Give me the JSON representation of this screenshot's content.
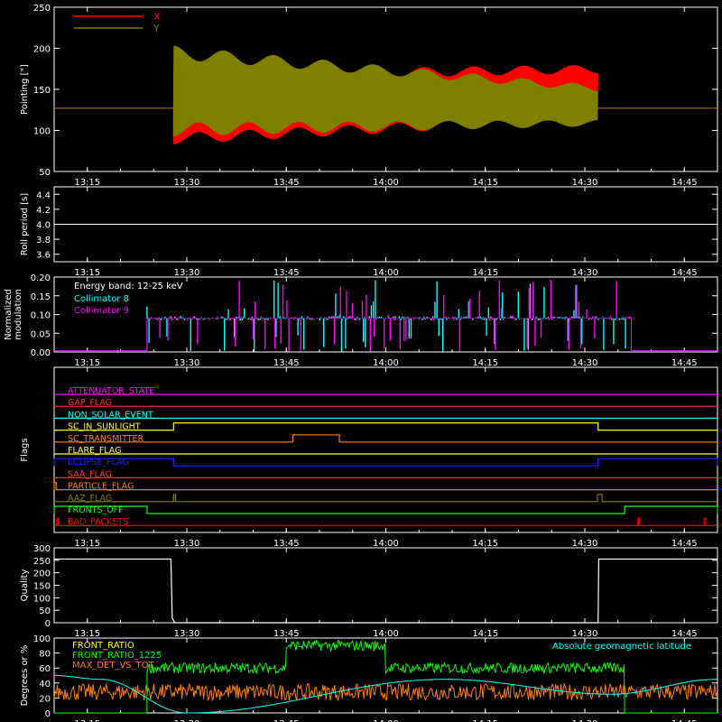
{
  "x_ticks": [
    "13:15",
    "13:30",
    "13:45",
    "14:00",
    "14:15",
    "14:30",
    "14:45"
  ],
  "chart_data": [
    {
      "type": "line",
      "ylabel": "Pointing [\"]",
      "ylim": [
        50,
        250
      ],
      "yticks": [
        "50",
        "100",
        "150",
        "200",
        "250"
      ],
      "legend": [
        {
          "name": "X",
          "color": "#ff0000"
        },
        {
          "name": "Y",
          "color": "#7f7f00"
        }
      ],
      "series": [
        {
          "name": "X",
          "color": "#ff0000",
          "pre": {
            "x": [
              "13:10",
              "13:28"
            ],
            "y": [
              127,
              127
            ]
          },
          "oscillation": {
            "start": "13:28",
            "end": "14:32",
            "center_start": 128,
            "center_end": 145,
            "amp_start": 45,
            "amp_end": 35
          },
          "post": {
            "x": [
              "14:32",
              "14:50"
            ],
            "y": [
              127,
              127
            ]
          }
        },
        {
          "name": "Y",
          "color": "#7f7f00",
          "pre": {
            "x": [
              "13:10",
              "13:28"
            ],
            "y": [
              127,
              127
            ]
          },
          "oscillation": {
            "start": "13:28",
            "end": "14:32",
            "center_start": 148,
            "center_end": 130,
            "amp_start": 55,
            "amp_end": 25
          },
          "post": {
            "x": [
              "14:32",
              "14:50"
            ],
            "y": [
              127,
              127
            ]
          }
        }
      ]
    },
    {
      "type": "line",
      "ylabel": "Roll period [s]",
      "ylim": [
        3.5,
        4.5
      ],
      "yticks": [
        "3.6",
        "3.8",
        "4.0",
        "4.2",
        "4.4"
      ],
      "series": [
        {
          "name": "Roll period",
          "color": "#ffffff",
          "x": [
            "13:10",
            "14:50"
          ],
          "y": [
            4.0,
            4.0
          ]
        }
      ]
    },
    {
      "type": "bar",
      "ylabel": [
        "Normalized",
        "modulation"
      ],
      "ylim": [
        0,
        0.2
      ],
      "yticks": [
        "0.00",
        "0.05",
        "0.10",
        "0.15",
        "0.20"
      ],
      "legend_title": "Energy band: 12-25 keV",
      "series": [
        {
          "name": "Collimator 8",
          "color": "#00ffff",
          "baseline": 0.09,
          "start": "13:24",
          "end": "14:37"
        },
        {
          "name": "Collimator 9",
          "color": "#ff00ff",
          "baseline": 0.09,
          "start": "13:24",
          "end": "14:37"
        }
      ]
    },
    {
      "type": "line",
      "ylabel": "Flags",
      "flags": [
        {
          "name": "ATTENUATOR_STATE",
          "color": "#ff00ff",
          "high": []
        },
        {
          "name": "GAP_FLAG",
          "color": "#ff3030",
          "high": []
        },
        {
          "name": "NON_SOLAR_EVENT",
          "color": "#00ffff",
          "high": []
        },
        {
          "name": "SC_IN_SUNLIGHT",
          "color": "#ffff00",
          "high": [
            [
              "13:28",
              "14:32"
            ]
          ]
        },
        {
          "name": "SC_TRANSMITTER",
          "color": "#ff8000",
          "high": [
            [
              "13:46",
              "13:53"
            ]
          ]
        },
        {
          "name": "FLARE_FLAG",
          "color": "#ffff40",
          "high": []
        },
        {
          "name": "ECLIPSE_FLAG",
          "color": "#2020ff",
          "high": [
            [
              "13:10",
              "13:28"
            ],
            [
              "14:32",
              "14:50"
            ]
          ]
        },
        {
          "name": "SAA_FLAG",
          "color": "#ff3030",
          "high": []
        },
        {
          "name": "PARTICLE_FLAG",
          "color": "#ff8000",
          "high": [
            [
              "13:10",
              "13:10.3"
            ]
          ]
        },
        {
          "name": "AAZ_FLAG",
          "color": "#808000",
          "high": [
            [
              "13:28",
              "13:28.3"
            ],
            [
              "14:31.9",
              "14:32.6"
            ]
          ]
        },
        {
          "name": "FRONTS_OFF",
          "color": "#00ff00",
          "high": [
            [
              "13:10",
              "13:24"
            ],
            [
              "14:36",
              "14:50"
            ]
          ]
        },
        {
          "name": "BAD_PACKETS",
          "color": "#ff0000",
          "high": [
            [
              "13:10.4",
              "13:10.5"
            ],
            [
              "14:38",
              "14:38.1"
            ],
            [
              "14:48",
              "14:48.1"
            ]
          ]
        }
      ]
    },
    {
      "type": "line",
      "ylabel": "Quality",
      "ylim": [
        0,
        300
      ],
      "yticks": [
        "0",
        "50",
        "100",
        "150",
        "200",
        "250",
        "300"
      ],
      "series": [
        {
          "name": "Quality",
          "color": "#ffffff",
          "x": [
            "13:10",
            "13:27.6",
            "13:27.8",
            "13:28.1",
            "13:28.3",
            "14:32",
            "14:32.1",
            "14:50"
          ],
          "y": [
            255,
            255,
            20,
            3,
            0,
            0,
            255,
            255
          ]
        }
      ]
    },
    {
      "type": "line",
      "ylabel": "Degrees or %",
      "ylim": [
        0,
        100
      ],
      "yticks": [
        "0",
        "20",
        "40",
        "60",
        "80",
        "100"
      ],
      "legend": [
        {
          "name": "FRONT_RATIO",
          "color": "#ffff00"
        },
        {
          "name": "FRONT_RATIO_1225",
          "color": "#00ff00"
        },
        {
          "name": "MAX_DET_VS_TOT",
          "color": "#ff8000"
        }
      ],
      "legend_right": {
        "name": "Absolute geomagnetic latitude",
        "color": "#00ffff"
      },
      "series": [
        {
          "name": "FRONT_RATIO_1225",
          "color": "#00ff00",
          "levels": [
            [
              "13:24",
              "13:45",
              60
            ],
            [
              "13:45",
              "14:00",
              90
            ],
            [
              "14:00",
              "14:36",
              60
            ]
          ]
        },
        {
          "name": "MAX_DET_VS_TOT",
          "color": "#ff8000",
          "level": 28
        },
        {
          "name": "Absolute geomagnetic latitude",
          "color": "#00ffff",
          "x": [
            "13:10",
            "13:17",
            "13:30",
            "14:09",
            "14:34",
            "14:50"
          ],
          "y": [
            50,
            45,
            0,
            45,
            25,
            45
          ]
        }
      ]
    }
  ]
}
